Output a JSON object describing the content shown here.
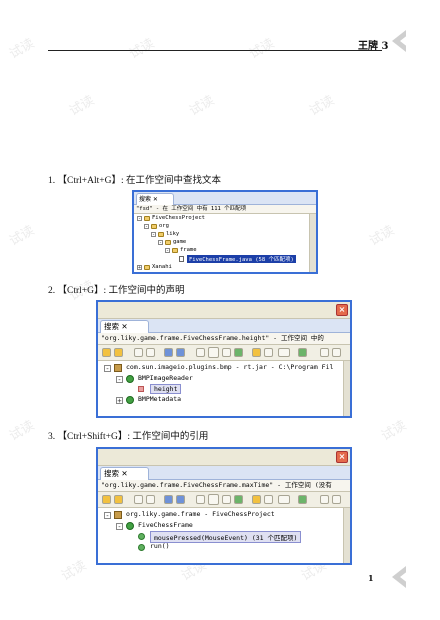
{
  "header": {
    "title": "王牌 3"
  },
  "page_number": "1",
  "watermark": "试读",
  "items": [
    {
      "label": "1. 【Ctrl+Alt+G】: 在工作空间中查找文本"
    },
    {
      "label": "2. 【Ctrl+G】: 工作空间中的声明"
    },
    {
      "label": "3. 【Ctrl+Shift+G】: 工作空间中的引用"
    }
  ],
  "windows": [
    {
      "tab": "搜索 ✕",
      "status": "\"fsd\" - 在 工作空间 中有 111 个匹配项",
      "tree": [
        "FiveChessProject",
        "org",
        "liky",
        "game",
        "frame",
        "FiveChessFrame.java (58 个匹配项)",
        "Xanahi"
      ]
    },
    {
      "tab": "搜索 ✕",
      "status": "\"org.liky.game.frame.FiveChessFrame.height\" - 工作空间 中的",
      "tree": [
        "com.sun.imageio.plugins.bmp - rt.jar - C:\\Program Fil",
        "BMPImageReader",
        "height",
        "BMPMetadata"
      ]
    },
    {
      "tab": "搜索 ✕",
      "status": "\"org.liky.game.frame.FiveChessFrame.maxTime\" - 工作空间 (没有",
      "tree": [
        "org.liky.game.frame - FiveChessProject",
        "FiveChessFrame",
        "mousePressed(MouseEvent) (31 个匹配项)",
        "run()"
      ]
    }
  ]
}
